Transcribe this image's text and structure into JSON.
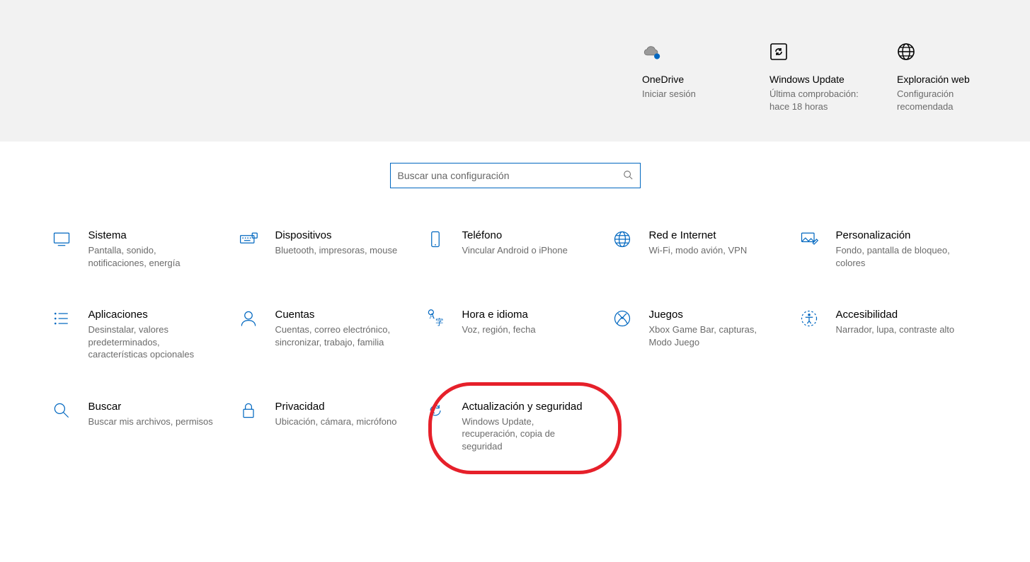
{
  "top_tiles": {
    "onedrive": {
      "title": "OneDrive",
      "sub": "Iniciar sesión"
    },
    "update": {
      "title": "Windows Update",
      "sub": "Última comprobación: hace 18 horas"
    },
    "web": {
      "title": "Exploración web",
      "sub": "Configuración recomendada"
    }
  },
  "search": {
    "placeholder": "Buscar una configuración"
  },
  "categories": {
    "system": {
      "title": "Sistema",
      "desc": "Pantalla, sonido, notificaciones, energía"
    },
    "devices": {
      "title": "Dispositivos",
      "desc": "Bluetooth, impresoras, mouse"
    },
    "phone": {
      "title": "Teléfono",
      "desc": "Vincular Android o iPhone"
    },
    "network": {
      "title": "Red e Internet",
      "desc": "Wi-Fi, modo avión, VPN"
    },
    "personalization": {
      "title": "Personalización",
      "desc": "Fondo, pantalla de bloqueo, colores"
    },
    "apps": {
      "title": "Aplicaciones",
      "desc": "Desinstalar, valores predeterminados, características opcionales"
    },
    "accounts": {
      "title": "Cuentas",
      "desc": "Cuentas, correo electrónico, sincronizar, trabajo, familia"
    },
    "time": {
      "title": "Hora e idioma",
      "desc": "Voz, región, fecha"
    },
    "gaming": {
      "title": "Juegos",
      "desc": "Xbox Game Bar, capturas, Modo Juego"
    },
    "accessibility": {
      "title": "Accesibilidad",
      "desc": "Narrador, lupa, contraste alto"
    },
    "search_cat": {
      "title": "Buscar",
      "desc": "Buscar mis archivos, permisos"
    },
    "privacy": {
      "title": "Privacidad",
      "desc": "Ubicación, cámara, micrófono"
    },
    "update_sec": {
      "title": "Actualización y seguridad",
      "desc": "Windows Update, recuperación, copia de seguridad"
    }
  }
}
